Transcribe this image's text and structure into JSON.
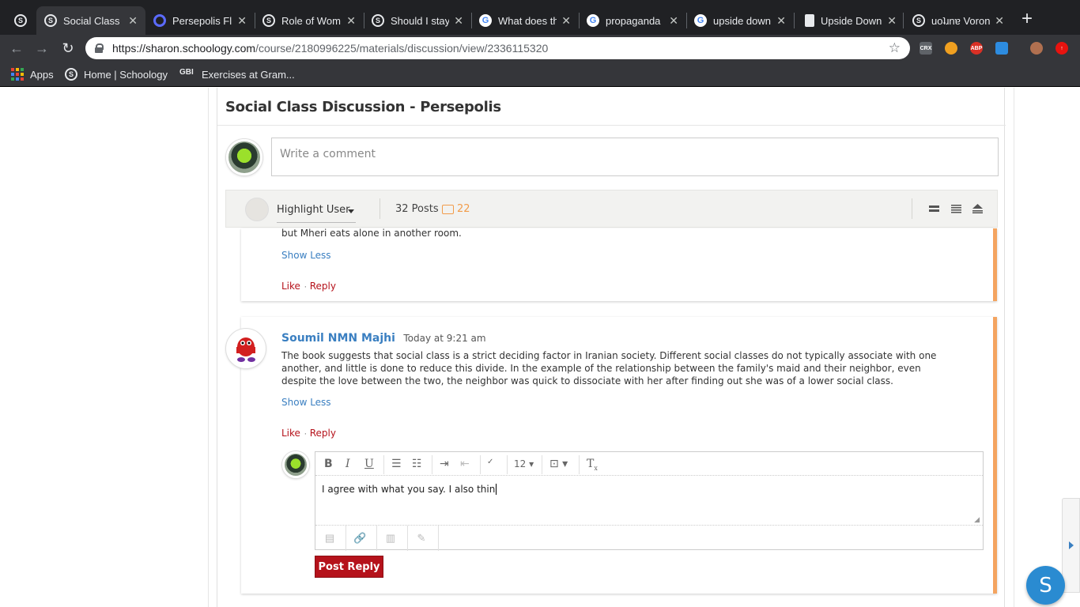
{
  "browser": {
    "tabs": [
      {
        "title": "",
        "favicon": "schoology-icon"
      },
      {
        "title": "Social Class",
        "favicon": "schoology-icon",
        "active": true
      },
      {
        "title": "Persepolis Fl",
        "favicon": "quizlet-icon"
      },
      {
        "title": "Role of Wom",
        "favicon": "schoology-icon"
      },
      {
        "title": "Should I stay",
        "favicon": "schoology-icon"
      },
      {
        "title": "What does th",
        "favicon": "google-icon"
      },
      {
        "title": "propaganda",
        "favicon": "google-icon"
      },
      {
        "title": "upside down",
        "favicon": "google-icon"
      },
      {
        "title": "Upside Down",
        "favicon": "document-icon"
      },
      {
        "title": "uoʇɹnɐ Voron",
        "favicon": "schoology-icon"
      }
    ],
    "url_host": "https://sharon.schoology.com",
    "url_path": "/course/2180996225/materials/discussion/view/2336115320",
    "extensions": [
      "CRX",
      "",
      "ABP",
      "",
      "",
      ""
    ],
    "bookmarks": [
      "Apps",
      "Home | Schoology",
      "Exercises at Gram..."
    ]
  },
  "discussion": {
    "title": "Social Class Discussion - Persepolis",
    "comment_placeholder": "Write a comment",
    "highlight_user_label": "Highlight User",
    "posts_count": "32 Posts",
    "new_count": "22"
  },
  "post1": {
    "text_tail": "but Mheri eats alone in another room.",
    "show_less": "Show Less",
    "like": "Like",
    "reply": "Reply"
  },
  "post2": {
    "author": "Soumil NMN Majhi",
    "timestamp": "Today at 9:21 am",
    "body": "The book suggests that social class is a strict deciding factor in Iranian society. Different social classes do not typically associate with one another, and little is done to reduce this divide. In the example of the relationship between the family's maid and their neighbor, even despite the love between the two, the neighbor was quick to dissociate with her after finding out she was of a lower social class.",
    "show_less": "Show Less",
    "like": "Like",
    "reply": "Reply"
  },
  "editor": {
    "font_size": "12",
    "draft_text": "I agree with what you say. I also thin",
    "post_reply_label": "Post Reply"
  },
  "help_button": "S",
  "colors": {
    "accent_red": "#b5121b",
    "link_blue": "#3a7fc1",
    "post_stripe": "#f4a460",
    "new_badge": "#f29c4a"
  }
}
